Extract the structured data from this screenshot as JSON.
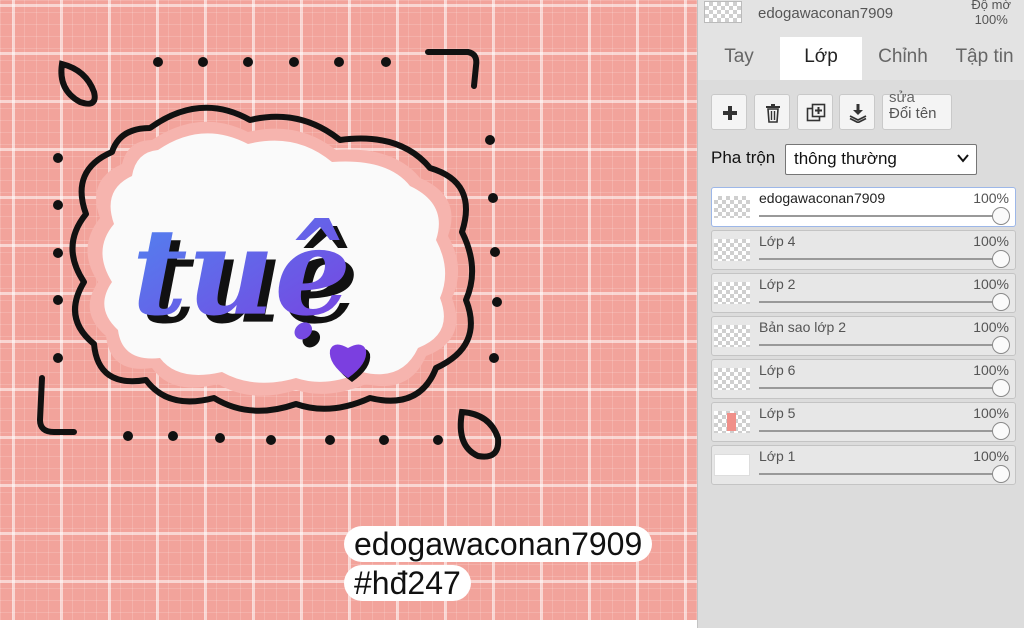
{
  "canvas": {
    "artwork_title": "tuệ",
    "sticker_lines": [
      "edogawaconan7909",
      "#hđ247"
    ],
    "colors": {
      "background": "#f2a39b",
      "grid": "#ffffff",
      "gradient_start": "#4f86f0",
      "gradient_end": "#7b3fe0"
    }
  },
  "panel": {
    "current_layer_name": "edogawaconan7909",
    "opacity_label": "Độ mờ",
    "opacity_value": "100%",
    "tabs": [
      {
        "label": "Tay",
        "active": false
      },
      {
        "label": "Lớp",
        "active": true
      },
      {
        "label": "Chỉnh",
        "active": false
      },
      {
        "label": "Tập tin",
        "active": false
      }
    ],
    "toolbar": {
      "add_icon": "plus-icon",
      "delete_icon": "trash-icon",
      "duplicate_icon": "duplicate-icon",
      "merge_icon": "merge-down-icon",
      "rename_top": "sửa",
      "rename_label": "Đổi tên"
    },
    "blend": {
      "label": "Pha trộn",
      "value": "thông thường"
    },
    "layers": [
      {
        "name": "edogawaconan7909",
        "opacity": "100%",
        "opacity_value": 1.0,
        "active": true
      },
      {
        "name": "Lớp 4",
        "opacity": "100%",
        "opacity_value": 1.0,
        "active": false
      },
      {
        "name": "Lớp 2",
        "opacity": "100%",
        "opacity_value": 1.0,
        "active": false
      },
      {
        "name": "Bản sao lớp 2",
        "opacity": "100%",
        "opacity_value": 1.0,
        "active": false
      },
      {
        "name": "Lớp 6",
        "opacity": "100%",
        "opacity_value": 1.0,
        "active": false
      },
      {
        "name": "Lớp 5",
        "opacity": "100%",
        "opacity_value": 1.0,
        "active": false
      },
      {
        "name": "Lớp 1",
        "opacity": "100%",
        "opacity_value": 1.0,
        "active": false
      }
    ]
  }
}
